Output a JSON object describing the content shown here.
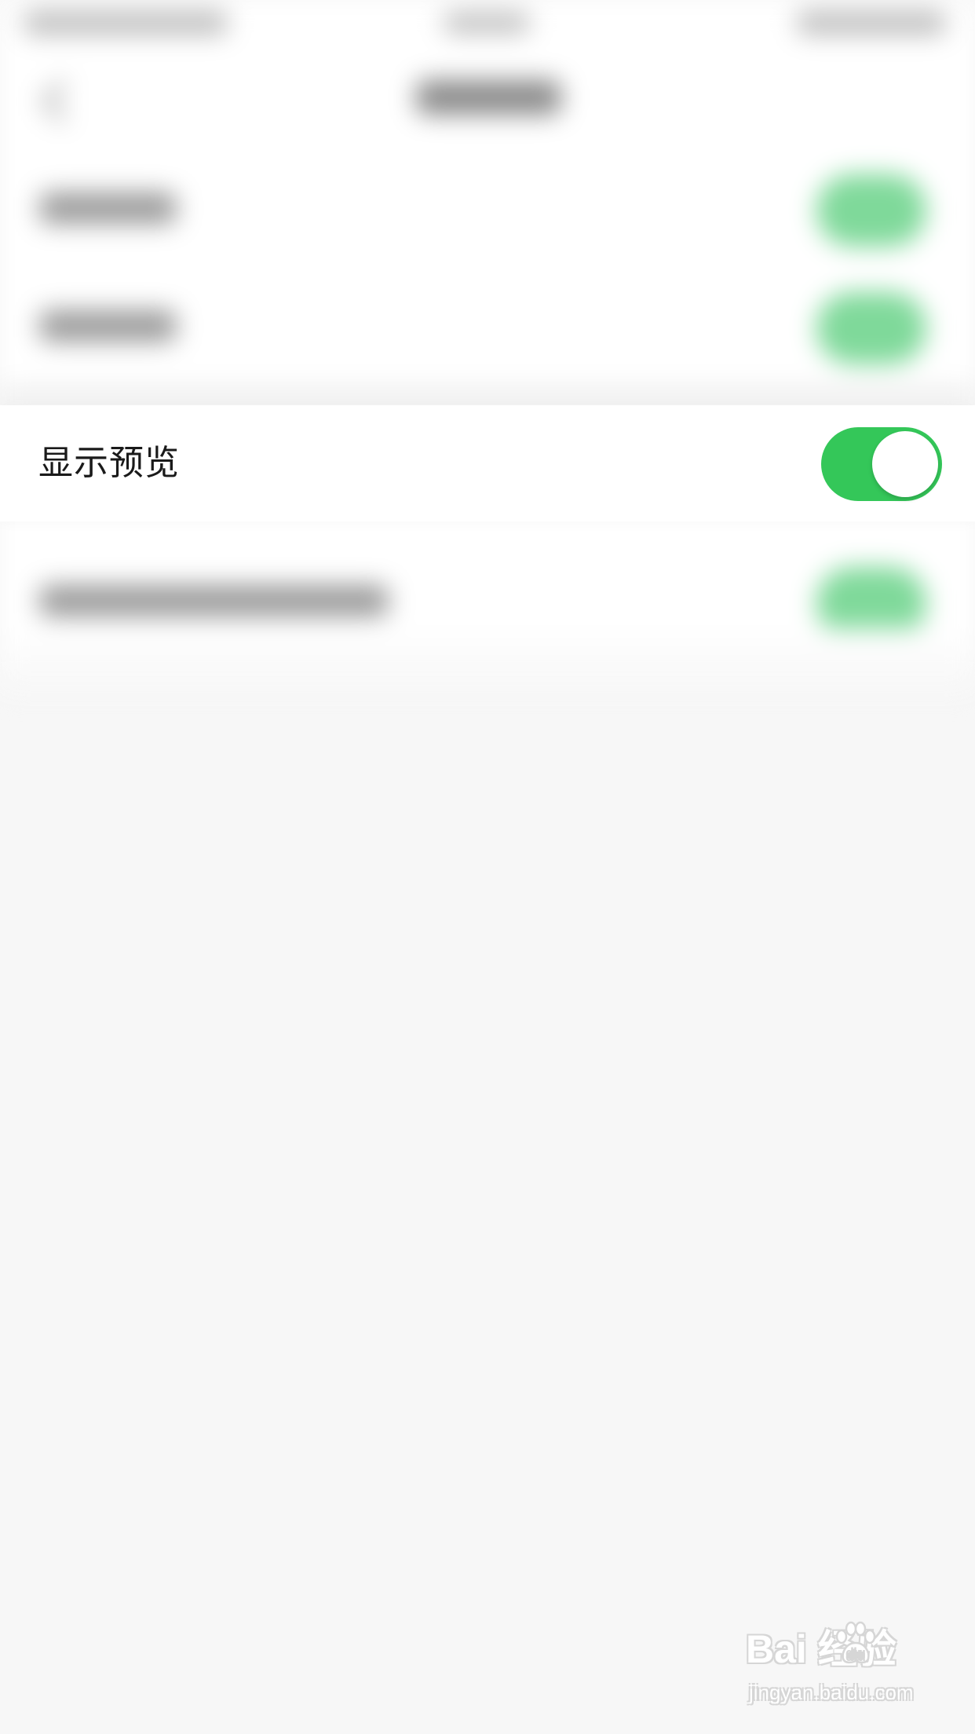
{
  "setting_row": {
    "label": "显示预览",
    "toggle_on": true
  },
  "colors": {
    "toggle_on": "#34c759",
    "page_background": "#f7f7f7",
    "row_background": "#ffffff",
    "label_text": "#1a1a1a"
  },
  "watermark": {
    "brand": "Bai  经验",
    "url": "jingyan.baidu.com",
    "icon": "paw-icon"
  }
}
